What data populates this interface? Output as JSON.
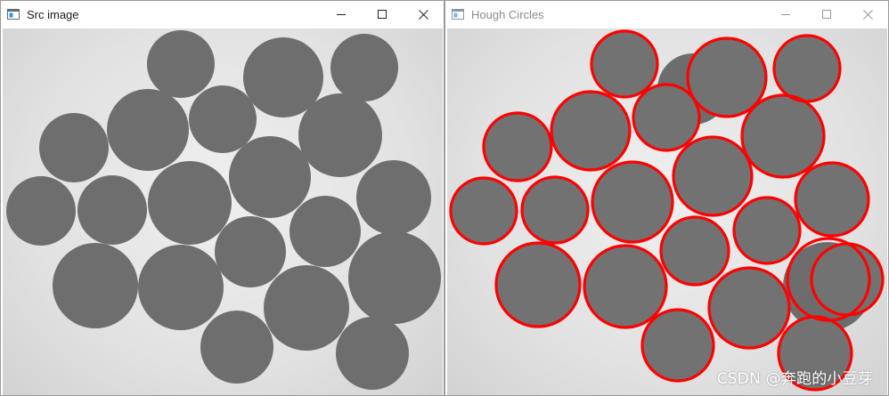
{
  "windows": {
    "src": {
      "title": "Src image",
      "controls": {
        "minimize_icon": "minimize-icon",
        "maximize_icon": "maximize-icon",
        "close_icon": "close-icon"
      }
    },
    "hough": {
      "title": "Hough Circles",
      "controls": {
        "minimize_icon": "minimize-icon",
        "maximize_icon": "maximize-icon",
        "close_icon": "close-icon"
      }
    }
  },
  "colors": {
    "disk_fill": "#6e6e6e",
    "background": "#e6e6e6",
    "detection_stroke": "#ff0000"
  },
  "watermark": "CSDN @奔跑的小豆芽"
}
